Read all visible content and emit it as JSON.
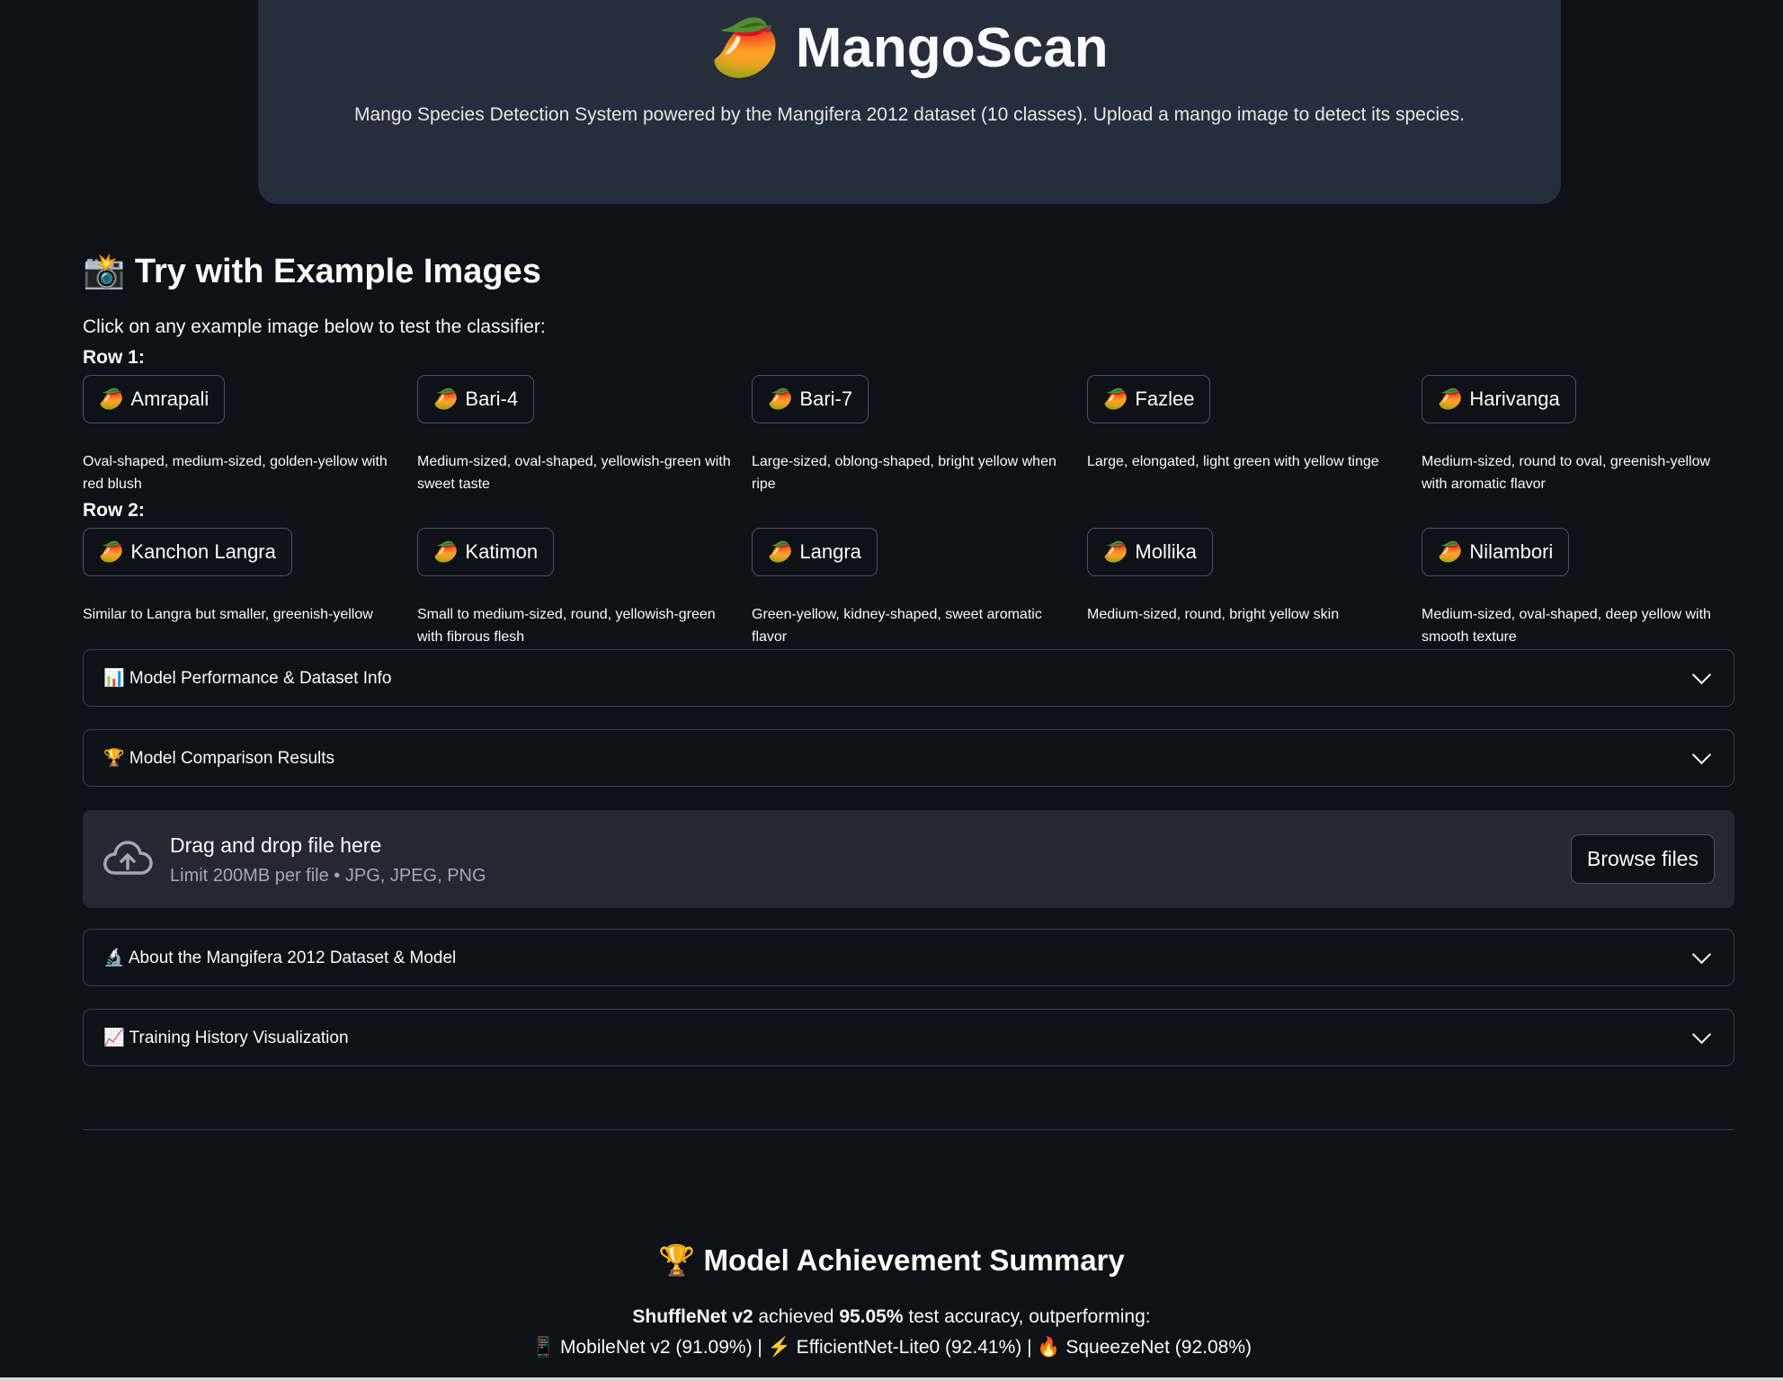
{
  "hero": {
    "title": "🥭 MangoScan",
    "subtitle": "Mango Species Detection System powered by the Mangifera 2012 dataset (10 classes). Upload a mango image to detect its species."
  },
  "examples": {
    "title": "📸 Try with Example Images",
    "intro": "Click on any example image below to test the classifier:",
    "row1_label": "Row 1:",
    "row2_label": "Row 2:",
    "row1": [
      {
        "icon": "🥭",
        "label": "Amrapali",
        "desc": "Oval-shaped, medium-sized, golden-yellow with red blush"
      },
      {
        "icon": "🥭",
        "label": "Bari-4",
        "desc": "Medium-sized, oval-shaped, yellowish-green with sweet taste"
      },
      {
        "icon": "🥭",
        "label": "Bari-7",
        "desc": "Large-sized, oblong-shaped, bright yellow when ripe"
      },
      {
        "icon": "🥭",
        "label": "Fazlee",
        "desc": "Large, elongated, light green with yellow tinge"
      },
      {
        "icon": "🥭",
        "label": "Harivanga",
        "desc": "Medium-sized, round to oval, greenish-yellow with aromatic flavor"
      }
    ],
    "row2": [
      {
        "icon": "🥭",
        "label": "Kanchon Langra",
        "desc": "Similar to Langra but smaller, greenish-yellow"
      },
      {
        "icon": "🥭",
        "label": "Katimon",
        "desc": "Small to medium-sized, round, yellowish-green with fibrous flesh"
      },
      {
        "icon": "🥭",
        "label": "Langra",
        "desc": "Green-yellow, kidney-shaped, sweet aromatic flavor"
      },
      {
        "icon": "🥭",
        "label": "Mollika",
        "desc": "Medium-sized, round, bright yellow skin"
      },
      {
        "icon": "🥭",
        "label": "Nilambori",
        "desc": "Medium-sized, oval-shaped, deep yellow with smooth texture"
      }
    ]
  },
  "expanders": {
    "performance": "📊 Model Performance & Dataset Info",
    "comparison": "🏆 Model Comparison Results",
    "about": "🔬 About the Mangifera 2012 Dataset & Model",
    "training": "📈 Training History Visualization"
  },
  "uploader": {
    "title": "Drag and drop file here",
    "limit": "Limit 200MB per file • JPG, JPEG, PNG",
    "browse": "Browse files"
  },
  "summary": {
    "title": "🏆 Model Achievement Summary",
    "model": "ShuffleNet v2",
    "achieved": " achieved ",
    "accuracy": "95.05%",
    "rest": " test accuracy, outperforming:",
    "others": "📱 MobileNet v2 (91.09%) | ⚡ EfficientNet-Lite0 (92.41%) | 🔥 SqueezeNet (92.08%)"
  },
  "colors": {
    "background": "#0e1117",
    "hero": "#262d3b",
    "uploader": "#262730"
  }
}
